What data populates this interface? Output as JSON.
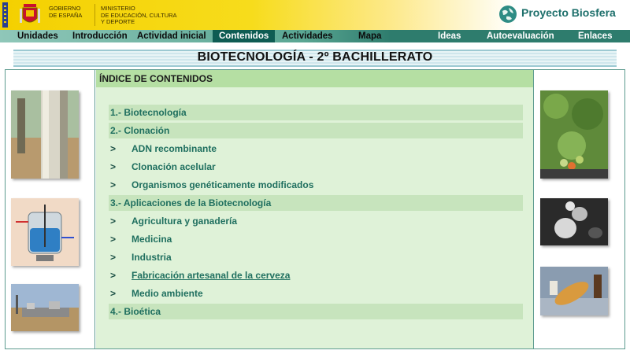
{
  "header": {
    "gov_text": "GOBIERNO\nDE ESPAÑA",
    "ministry_text": "MINISTERIO\nDE EDUCACIÓN, CULTURA\nY DEPORTE",
    "brand": "Proyecto Biosfera"
  },
  "nav": {
    "left": [
      {
        "label": "Unidades"
      },
      {
        "label": "Introducción"
      },
      {
        "label": "Actividad inicial"
      },
      {
        "label": "Contenidos",
        "active": true
      },
      {
        "label": "Actividades"
      },
      {
        "label": "Mapa"
      }
    ],
    "right": [
      {
        "label": "Ideas"
      },
      {
        "label": "Autoevaluación"
      },
      {
        "label": "Enlaces"
      }
    ]
  },
  "page_title": "BIOTECNOLOGÍA - 2º BACHILLERATO",
  "index": {
    "heading": "ÍNDICE DE CONTENIDOS",
    "items": [
      {
        "label": "1.- Biotecnología",
        "level": 1
      },
      {
        "label": "2.- Clonación",
        "level": 1
      },
      {
        "label": "ADN recombinante",
        "level": 2
      },
      {
        "label": "Clonación acelular",
        "level": 2
      },
      {
        "label": "Organismos genéticamente modificados",
        "level": 2
      },
      {
        "label": "3.- Aplicaciones de la Biotecnología",
        "level": 1
      },
      {
        "label": "Agricultura y ganadería",
        "level": 2
      },
      {
        "label": "Medicina",
        "level": 2
      },
      {
        "label": "Industria",
        "level": 2
      },
      {
        "label": "Fabricación artesanal de la cerveza",
        "level": 2,
        "underlined": true
      },
      {
        "label": "Medio ambiente",
        "level": 2
      },
      {
        "label": "4.- Bioética",
        "level": 1
      }
    ],
    "chevron": ">"
  },
  "colors": {
    "brand": "#1d6f6b",
    "nav_active": "#0e5c53",
    "content_bg": "#dff2d8",
    "band": "#c7e4bd",
    "link_text": "#1f6f5f"
  }
}
